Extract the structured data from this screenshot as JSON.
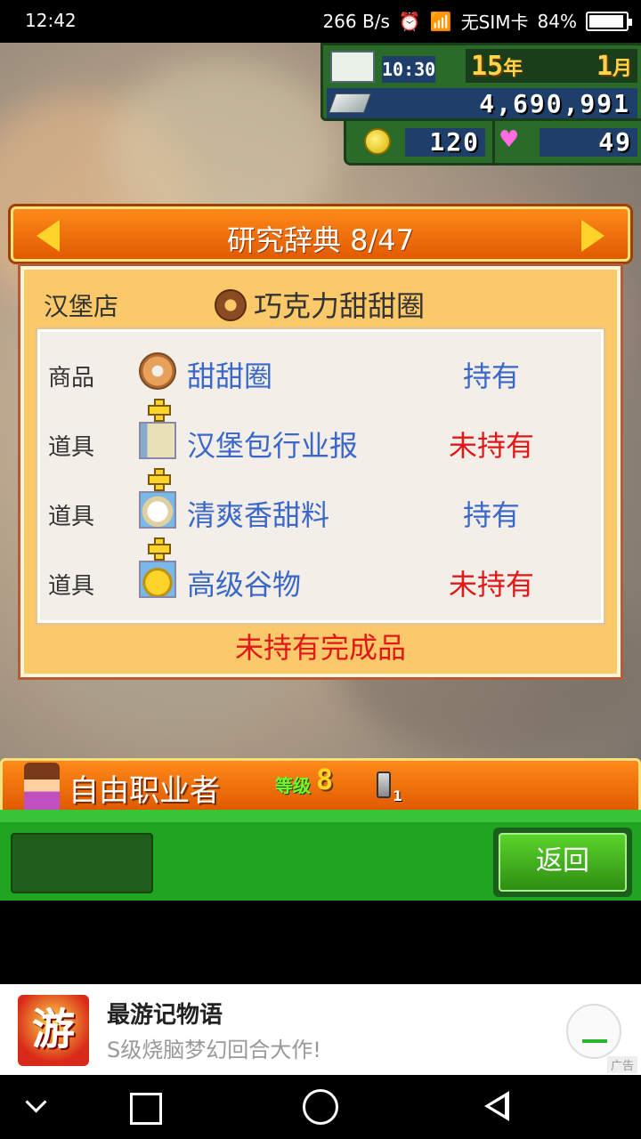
{
  "status_bar": {
    "time": "12:42",
    "net_speed": "266 B/s",
    "alarm_icon": "alarm-clock-icon",
    "wifi_icon": "wifi-icon",
    "sim": "无SIM卡",
    "battery": "84%"
  },
  "hud": {
    "clock": "10:30",
    "year": "15",
    "year_unit": "年",
    "month": "1",
    "month_unit": "月",
    "money": "4,690,991",
    "coins": "120",
    "hearts": "49"
  },
  "dictionary": {
    "title": "研究辞典 8/47",
    "shop": "汉堡店",
    "product": "巧克力甜甜圈",
    "rows": [
      {
        "type": "商品",
        "name": "甜甜圈",
        "status": "持有",
        "owned": true
      },
      {
        "type": "道具",
        "name": "汉堡包行业报",
        "status": "未持有",
        "owned": false
      },
      {
        "type": "道具",
        "name": "清爽香甜料",
        "status": "持有",
        "owned": true
      },
      {
        "type": "道具",
        "name": "高级谷物",
        "status": "未持有",
        "owned": false
      }
    ],
    "footer": "未持有完成品"
  },
  "character": {
    "job": "自由职业者",
    "level_label": "等级",
    "level": "8",
    "item_count": "1"
  },
  "buttons": {
    "back": "返回"
  },
  "ad": {
    "icon_char": "游",
    "title": "最游记物语",
    "subtitle": "S级烧脑梦幻回合大作!",
    "tag": "广告"
  },
  "colors": {
    "owned": "#3a68c8",
    "unowned": "#e01818",
    "header_orange": "#ff8a1a",
    "panel_bg": "#fbc86a",
    "green": "#1fa51f"
  }
}
